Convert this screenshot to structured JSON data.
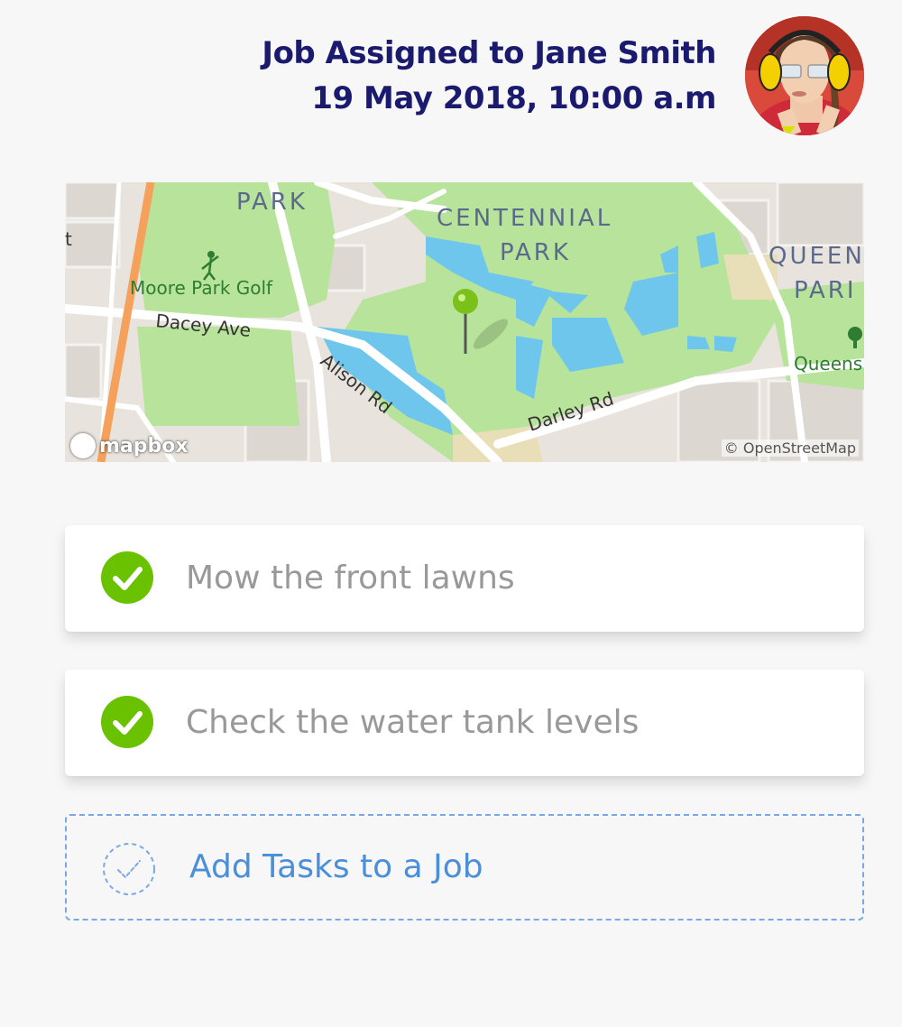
{
  "header": {
    "title_line1": "Job Assigned to Jane Smith",
    "title_line2": "19 May 2018, 10:00 a.m",
    "avatar_name": "Jane Smith",
    "title_color": "#1a1a6e"
  },
  "map": {
    "labels": {
      "park": "PARK",
      "centennial_1": "CENTENNIAL",
      "centennial_2": "PARK",
      "queens_1": "QUEEN",
      "queens_2": "PARI",
      "golf": "Moore Park Golf",
      "dacey": "Dacey Ave",
      "alison": "Alison Rd",
      "darley": "Darley Rd",
      "queens_small": "Queens",
      "left_t": "t"
    },
    "attribution": "© OpenStreetMap",
    "logo": "mapbox",
    "pin_color": "#7cc11a"
  },
  "tasks": [
    {
      "label": "Mow the front lawns",
      "done": true,
      "icon": "check-circle-icon"
    },
    {
      "label": "Check the water tank levels",
      "done": true,
      "icon": "check-circle-icon"
    }
  ],
  "add_task": {
    "label": "Add Tasks to a Job",
    "icon": "add-task-icon"
  },
  "colors": {
    "accent_green": "#6ac100",
    "link_blue": "#4a8fd9"
  }
}
